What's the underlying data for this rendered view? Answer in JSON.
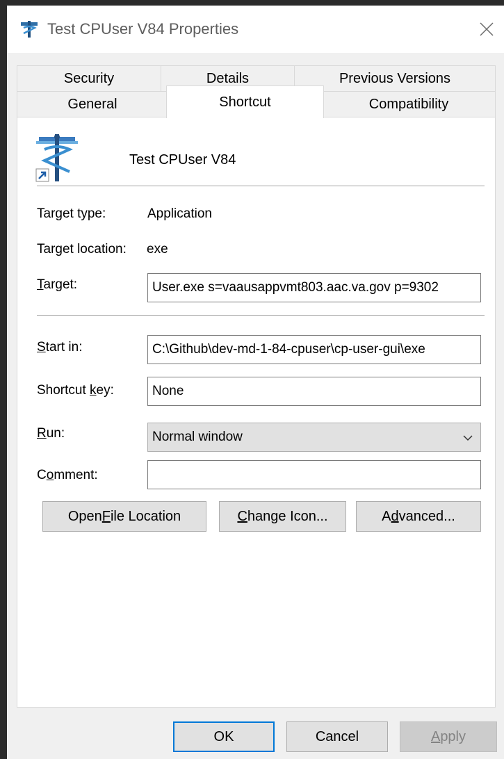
{
  "window": {
    "title": "Test CPUser V84 Properties"
  },
  "tabs": {
    "row1": [
      {
        "label": "Security"
      },
      {
        "label": "Details"
      },
      {
        "label": "Previous Versions"
      }
    ],
    "row2": [
      {
        "label": "General"
      },
      {
        "label": "Shortcut",
        "active": true
      },
      {
        "label": "Compatibility"
      }
    ]
  },
  "shortcut": {
    "name": "Test CPUser V84",
    "icon": "caduceus-shortcut-icon"
  },
  "fields": {
    "target_type": {
      "label": "Target type:",
      "value": "Application"
    },
    "target_location": {
      "label": "Target location:",
      "value": "exe"
    },
    "target": {
      "label_u": "T",
      "label_rest": "arget:",
      "value": "User.exe s=vaausappvmt803.aac.va.gov p=9302"
    },
    "start_in": {
      "label_u": "S",
      "label_rest": "tart in:",
      "value": "C:\\Github\\dev-md-1-84-cpuser\\cp-user-gui\\exe"
    },
    "shortcut_key": {
      "label_pre": "Shortcut ",
      "label_u": "k",
      "label_rest": "ey:",
      "value": "None"
    },
    "run": {
      "label_u": "R",
      "label_rest": "un:",
      "value": "Normal window"
    },
    "comment": {
      "label_pre": "C",
      "label_u": "o",
      "label_rest": "mment:",
      "value": ""
    }
  },
  "buttons": {
    "open_file": {
      "pre": "Open ",
      "u": "F",
      "post": "ile Location"
    },
    "change_icon": {
      "pre": "",
      "u": "C",
      "post": "hange Icon..."
    },
    "advanced": {
      "pre": "A",
      "u": "d",
      "post": "vanced..."
    },
    "ok": "OK",
    "cancel": "Cancel",
    "apply": {
      "u": "A",
      "post": "pply"
    }
  },
  "colors": {
    "dialog_bg": "#f0f0f0",
    "panel_bg": "#ffffff",
    "button_bg": "#e1e1e1",
    "title_text": "#5e5e5e"
  }
}
